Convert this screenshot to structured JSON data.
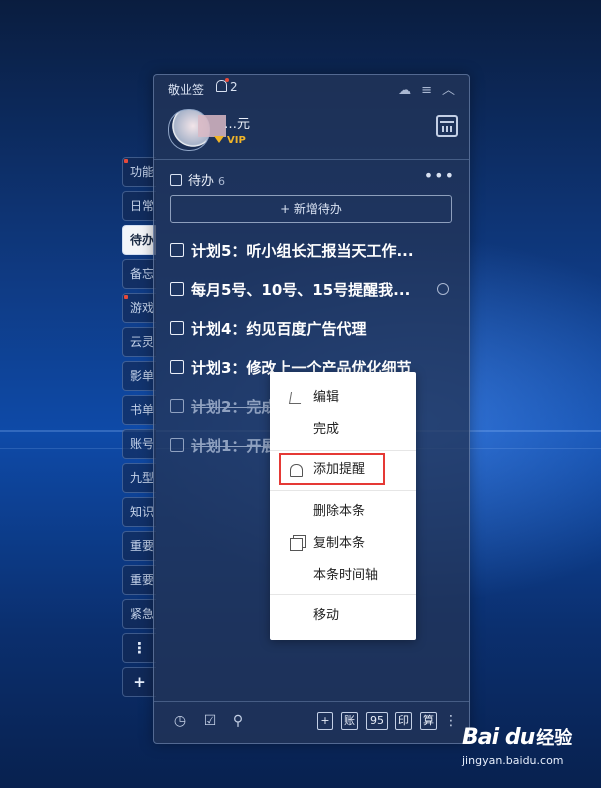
{
  "app": {
    "name": "敬业签",
    "notification_count": "2"
  },
  "user": {
    "name_partial": "…元",
    "vip_label": "VIP"
  },
  "side_tabs": [
    {
      "label": "功能",
      "dot": true
    },
    {
      "label": "日常",
      "dot": false
    },
    {
      "label": "待办",
      "dot": false,
      "active": true
    },
    {
      "label": "备忘",
      "dot": false
    },
    {
      "label": "游戏",
      "dot": true
    },
    {
      "label": "云灵",
      "dot": false
    },
    {
      "label": "影单",
      "dot": false
    },
    {
      "label": "书单",
      "dot": false
    },
    {
      "label": "账号",
      "dot": false
    },
    {
      "label": "九型",
      "dot": false
    },
    {
      "label": "知识",
      "dot": false
    },
    {
      "label": "重要",
      "dot": false
    },
    {
      "label": "重要",
      "dot": false
    },
    {
      "label": "紧急",
      "dot": false
    }
  ],
  "side_tab_more": "⋮",
  "side_tab_add": "+",
  "section": {
    "title": "待办",
    "count": "6",
    "more": "•••",
    "add_label": "+ 新增待办"
  },
  "todos": [
    {
      "text": "计划5：听小组长汇报当天工作...",
      "done": false,
      "has_clock": false
    },
    {
      "text": "每月5号、10号、15号提醒我...",
      "done": false,
      "has_clock": true
    },
    {
      "text": "计划4：约见百度广告代理",
      "done": false,
      "has_clock": false
    },
    {
      "text": "计划3：修改上一个产品优化细节",
      "done": false,
      "has_clock": false
    },
    {
      "text": "计划2：完成",
      "done": true,
      "has_clock": false
    },
    {
      "text": "计划1：开展",
      "done": true,
      "has_clock": false
    }
  ],
  "bottom_buttons": [
    "+",
    "账",
    "95",
    "印",
    "算"
  ],
  "bottom_more": "⋮",
  "context_menu": {
    "edit": "编辑",
    "complete": "完成",
    "add_reminder": "添加提醒",
    "delete": "删除本条",
    "copy": "复制本条",
    "timeline": "本条时间轴",
    "move": "移动"
  },
  "watermark": {
    "logo": "Bai du",
    "text": "经验",
    "url": "jingyan.baidu.com"
  },
  "colors": {
    "highlight": "#e53935",
    "vip": "#f0b429",
    "badge": "#e64a3b"
  }
}
